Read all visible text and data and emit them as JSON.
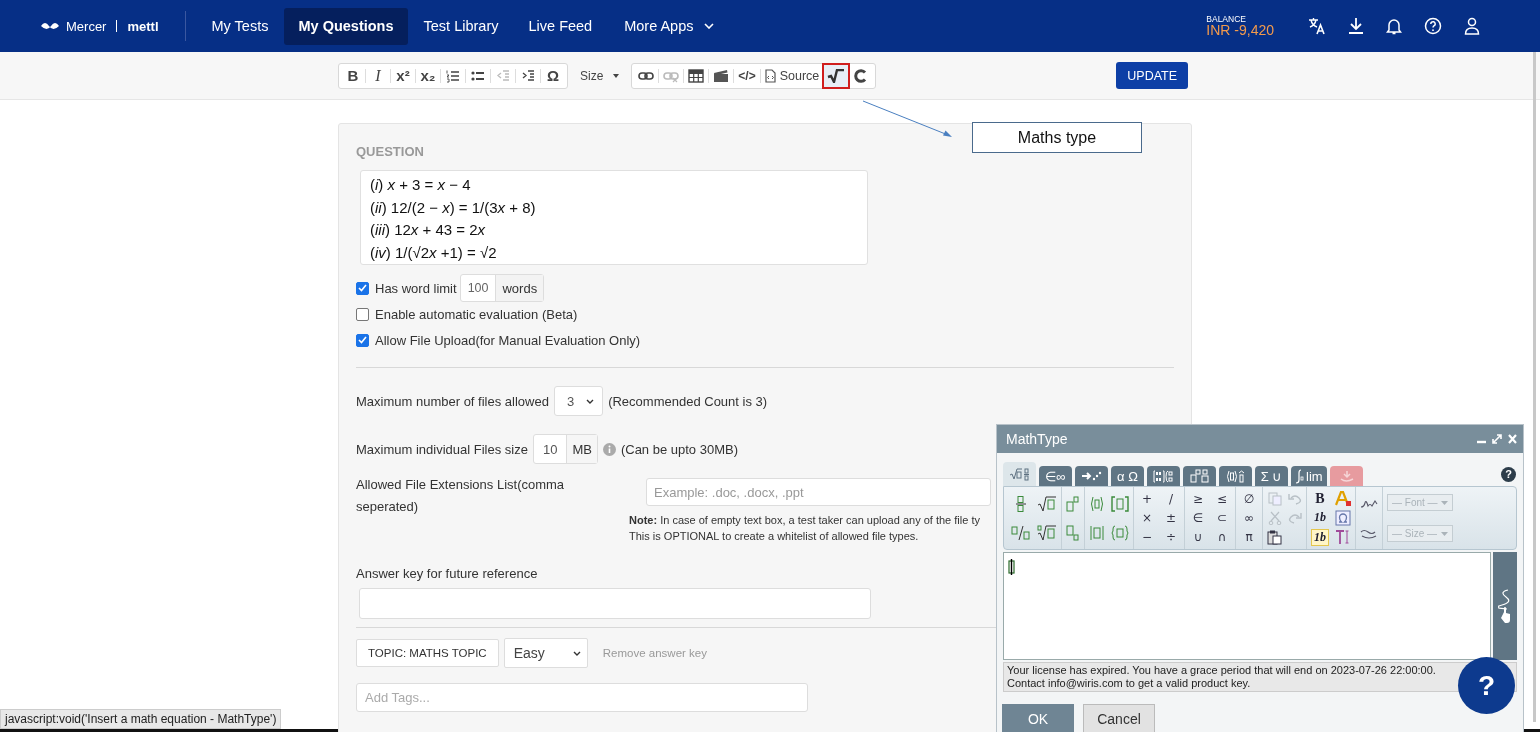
{
  "nav": {
    "brand": "Mercer",
    "product": "mettl",
    "items": [
      {
        "label": "My Tests",
        "selected": false
      },
      {
        "label": "My Questions",
        "selected": true
      },
      {
        "label": "Test Library",
        "selected": false
      },
      {
        "label": "Live Feed",
        "selected": false
      }
    ],
    "more_apps": "More Apps",
    "balance_label": "BALANCE",
    "balance_value": "INR -9,420"
  },
  "toolbar": {
    "bold": "B",
    "italic": "I",
    "superscript": "x²",
    "subscript": "x₂",
    "special_char": "Ω",
    "size": "Size",
    "code": "</>",
    "source": "Source",
    "math_button": {
      "selected": true
    },
    "update_button": "UPDATE"
  },
  "annotation": {
    "text": "Maths type"
  },
  "question": {
    "heading": "QUESTION",
    "lines": [
      [
        {
          "text": "("
        },
        {
          "text": "i",
          "italic": true
        },
        {
          "text": ") "
        },
        {
          "text": "x",
          "italic": true
        },
        {
          "text": " + 3 = "
        },
        {
          "text": "x",
          "italic": true
        },
        {
          "text": " − 4"
        }
      ],
      [
        {
          "text": "("
        },
        {
          "text": "ii",
          "italic": true
        },
        {
          "text": ") 12/(2 − "
        },
        {
          "text": "x",
          "italic": true
        },
        {
          "text": ") = 1/(3"
        },
        {
          "text": "x",
          "italic": true
        },
        {
          "text": " + 8)"
        }
      ],
      [
        {
          "text": "("
        },
        {
          "text": "iii",
          "italic": true
        },
        {
          "text": ") 12"
        },
        {
          "text": "x",
          "italic": true
        },
        {
          "text": " + 43 = 2"
        },
        {
          "text": "x",
          "italic": true
        }
      ],
      [
        {
          "text": "("
        },
        {
          "text": "iv",
          "italic": true
        },
        {
          "text": ") 1/(√2"
        },
        {
          "text": "x",
          "italic": true
        },
        {
          "text": " +1) = √2"
        }
      ]
    ],
    "options": [
      {
        "kind": "word_limit",
        "label": "Has word limit",
        "checked": true,
        "value": "100",
        "unit": "words"
      },
      {
        "kind": "plain",
        "label": "Enable automatic evaluation (Beta)",
        "checked": false
      },
      {
        "kind": "plain",
        "label": "Allow File Upload(for Manual Evaluation Only)",
        "checked": true
      }
    ]
  },
  "files": {
    "max_count_label": "Maximum number of files allowed",
    "max_count_value": "3",
    "max_count_note": "(Recommended Count is 3)",
    "max_size_label": "Maximum individual Files size",
    "max_size_value": "10",
    "max_size_unit": "MB",
    "max_size_note": "(Can be upto 30MB)",
    "extensions_label": "Allowed File Extensions List(comma seperated)",
    "extensions_placeholder": "Example: .doc, .docx, .ppt",
    "extensions_note": [
      "**Note:** In case of empty text box, a test taker can upload any of the file ty",
      "This is OPTIONAL to create a whitelist of allowed file types."
    ]
  },
  "answer_key": {
    "label": "Answer key for future reference"
  },
  "topic": {
    "label": "TOPIC:  MATHS TOPIC",
    "difficulty": "Easy",
    "remove_link": "Remove answer key",
    "tags_placeholder": "Add Tags..."
  },
  "status_tooltip": "javascript:void('Insert a math equation - MathType')",
  "help_button": "?",
  "mathtype": {
    "title": "MathType",
    "help": "?",
    "tabs": [
      {
        "kind": "templates",
        "selected": true
      },
      {
        "kind": "text",
        "label": "∈∞",
        "selected": false
      },
      {
        "kind": "arrows",
        "selected": false
      },
      {
        "kind": "text",
        "label": "α Ω",
        "selected": false
      },
      {
        "kind": "matrix",
        "selected": false
      },
      {
        "kind": "scripts",
        "selected": false
      },
      {
        "kind": "brackets",
        "selected": false
      },
      {
        "kind": "text",
        "label": "Σ ∪",
        "selected": false
      },
      {
        "kind": "calculus",
        "label": "lim",
        "selected": false
      },
      {
        "kind": "chemistry",
        "selected": false
      }
    ],
    "operators": [
      [
        "+",
        "/"
      ],
      [
        "×",
        "±"
      ],
      [
        "−",
        "÷"
      ]
    ],
    "relations": [
      [
        "≥",
        "≤"
      ],
      [
        "∈",
        "⊂"
      ],
      [
        "∪",
        "∩"
      ]
    ],
    "misc": [
      "∅",
      "∞",
      "π"
    ],
    "bold": "B",
    "italic_styles": [
      {
        "label": "1b",
        "selected": false
      },
      {
        "label": "1b",
        "selected": true
      }
    ],
    "font_select": "— Font —",
    "size_select": "— Size —",
    "license": [
      "Your license has expired. You have a grace period that will end on 2023-07-26 22:00:00.",
      "Contact info@wiris.com to get a valid product key."
    ],
    "ok": "OK",
    "cancel": "Cancel"
  }
}
